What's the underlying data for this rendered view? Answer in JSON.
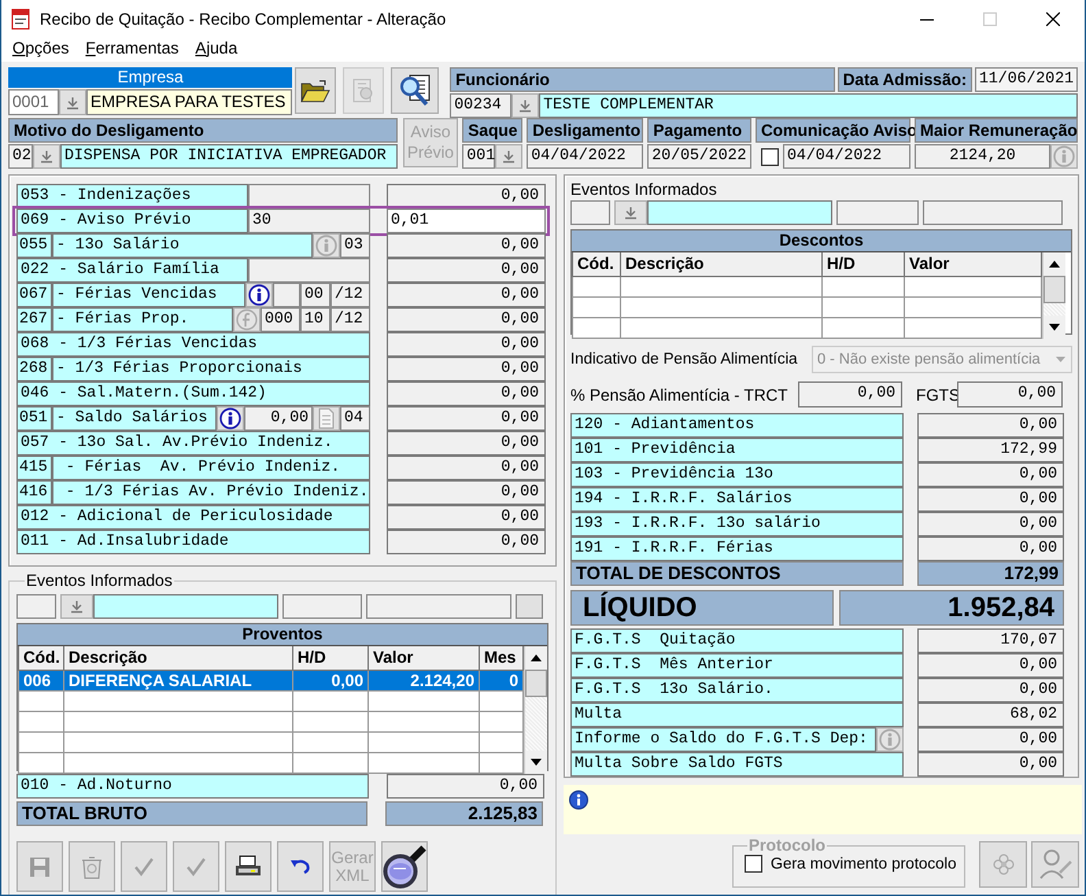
{
  "window": {
    "title": "Recibo de Quitação - Recibo Complementar - Alteração"
  },
  "menu": [
    "Opções",
    "Ferramentas",
    "Ajuda"
  ],
  "empresa": {
    "label": "Empresa",
    "code": "0001",
    "name": "EMPRESA PARA TESTES"
  },
  "top_buttons": [
    {
      "kind": "open-folder",
      "disabled": false
    },
    {
      "kind": "report",
      "disabled": true
    },
    {
      "kind": "search-document",
      "disabled": false
    }
  ],
  "funcionario": {
    "label": "Funcionário",
    "code": "00234",
    "name": "TESTE COMPLEMENTAR"
  },
  "admissao": {
    "label": "Data Admissão:",
    "value": "11/06/2021"
  },
  "motivo": {
    "label": "Motivo do Desligamento",
    "code": "02",
    "name": "DISPENSA POR INICIATIVA EMPREGADOR"
  },
  "aviso_previo_button": {
    "label": "Aviso Prévio",
    "disabled": true
  },
  "saque": {
    "label": "Saque",
    "value": "001"
  },
  "dates": [
    {
      "label": "Desligamento",
      "value": "04/04/2022"
    },
    {
      "label": "Pagamento",
      "value": "20/05/2022"
    }
  ],
  "comunicacao_aviso": {
    "label": "Comunicação Aviso",
    "checked": false,
    "value": "04/04/2022"
  },
  "maior_remuneracao": {
    "label": "Maior Remuneração",
    "value": "2124,20"
  },
  "verbas": [
    {
      "label": "053 - Indenizações",
      "extras": [
        {
          "kind": "field"
        }
      ],
      "value": "0,00",
      "focused": false
    },
    {
      "label": "069 - Aviso Prévio",
      "extras": [
        {
          "kind": "field",
          "text": "30"
        }
      ],
      "value": "0,01",
      "focused": true
    },
    {
      "code": "055",
      "label": "- 13o Salário",
      "extras": [
        {
          "kind": "info",
          "disabled": true
        },
        {
          "kind": "field",
          "text": "03"
        }
      ],
      "value": "0,00",
      "focused": false
    },
    {
      "label": "022 - Salário Família",
      "extras": [
        {
          "kind": "field"
        }
      ],
      "value": "0,00",
      "focused": false
    },
    {
      "code": "067",
      "label": "- Férias Vencidas",
      "extras": [
        {
          "kind": "info",
          "disabled": false
        },
        {
          "kind": "field"
        },
        {
          "kind": "field",
          "text": "00"
        },
        {
          "kind": "field",
          "text": "/12"
        }
      ],
      "value": "0,00",
      "focused": false
    },
    {
      "code": "267",
      "label": "- Férias Prop.",
      "extras": [
        {
          "kind": "function",
          "disabled": true
        },
        {
          "kind": "field",
          "text": "000"
        },
        {
          "kind": "field",
          "text": "10"
        },
        {
          "kind": "field",
          "text": "/12"
        }
      ],
      "value": "0,00",
      "focused": false
    },
    {
      "label": "068 - 1/3 Férias Vencidas",
      "value": "0,00",
      "focused": false
    },
    {
      "code": "268",
      "label": "- 1/3 Férias Proporcionais",
      "value": "0,00",
      "focused": false
    },
    {
      "label": "046 - Sal.Matern.(Sum.142)",
      "value": "0,00",
      "focused": false
    },
    {
      "code": "051",
      "label": "- Saldo Salários",
      "extras": [
        {
          "kind": "info",
          "disabled": false
        },
        {
          "kind": "field",
          "text": "0,00"
        },
        {
          "kind": "document",
          "disabled": true
        },
        {
          "kind": "field",
          "text": "04"
        }
      ],
      "value": "0,00",
      "focused": false
    },
    {
      "label": "057 - 13o Sal. Av.Prévio Indeniz.",
      "value": "0,00",
      "focused": false
    },
    {
      "code": "415",
      "label": " - Férias  Av. Prévio Indeniz.",
      "value": "0,00",
      "focused": false
    },
    {
      "code": "416",
      "label": " - 1/3 Férias Av. Prévio Indeniz.",
      "value": "0,00",
      "focused": false
    },
    {
      "label": "012 - Adicional de Periculosidade",
      "value": "0,00",
      "focused": false
    },
    {
      "label": "011 - Ad.Insalubridade",
      "value": "0,00",
      "focused": false
    }
  ],
  "eventos_proventos": {
    "title": "Eventos Informados",
    "grid_title": "Proventos",
    "columns": [
      "Cód.",
      "Descrição",
      "H/D",
      "Valor",
      "Mes"
    ],
    "rows": [
      {
        "cells": [
          "006",
          "DIFERENÇA SALARIAL",
          "0,00",
          "2.124,20",
          "0"
        ],
        "selected": true
      }
    ]
  },
  "ad_noturno": {
    "label": "010 - Ad.Noturno",
    "value": "0,00"
  },
  "total_bruto": {
    "label": "TOTAL BRUTO",
    "value": "2.125,83"
  },
  "toolbar": [
    {
      "kind": "save",
      "disabled": true
    },
    {
      "kind": "recycle",
      "disabled": true
    },
    {
      "kind": "check",
      "disabled": true
    },
    {
      "kind": "check",
      "disabled": true
    },
    {
      "kind": "print",
      "disabled": false
    },
    {
      "kind": "undo",
      "disabled": false
    },
    {
      "kind": "text",
      "label": "Gerar XML",
      "disabled": true
    },
    {
      "kind": "magnifier",
      "disabled": false
    }
  ],
  "eventos_descontos": {
    "title": "Eventos Informados",
    "grid_title": "Descontos",
    "columns": [
      "Cód.",
      "Descrição",
      "H/D",
      "Valor"
    ]
  },
  "pensao": {
    "label": "Indicativo de Pensão Alimentícia",
    "value": "0 - Não existe pensão alimentícia",
    "disabled": true
  },
  "pensao_trct": {
    "label": "% Pensão Alimentícia - TRCT",
    "value": "0,00"
  },
  "fgts": {
    "label": "FGTS",
    "value": "0,00"
  },
  "descontos": [
    {
      "label": "120 - Adiantamentos",
      "value": "0,00"
    },
    {
      "label": "101 - Previdência",
      "value": "172,99"
    },
    {
      "label": "103 - Previdência 13o",
      "value": "0,00"
    },
    {
      "label": "194 - I.R.R.F. Salários",
      "value": "0,00"
    },
    {
      "label": "193 - I.R.R.F. 13o salário",
      "value": "0,00"
    },
    {
      "label": "191 - I.R.R.F. Férias",
      "value": "0,00"
    }
  ],
  "total_descontos": {
    "label": "TOTAL DE DESCONTOS",
    "value": "172,99"
  },
  "liquido": {
    "label": "LÍQUIDO",
    "value": "1.952,84"
  },
  "fgts_rows": [
    {
      "label": "F.G.T.S  Quitação",
      "value": "170,07",
      "info_button": false
    },
    {
      "label": "F.G.T.S  Mês Anterior",
      "value": "0,00",
      "info_button": false
    },
    {
      "label": "F.G.T.S  13o Salário.",
      "value": "0,00",
      "info_button": false
    },
    {
      "label": "Multa",
      "value": "68,02",
      "info_button": false
    },
    {
      "label": "Informe o Saldo do F.G.T.S Dep:",
      "value": "0,00",
      "info_button": true
    },
    {
      "label": "Multa Sobre Saldo FGTS",
      "value": "0,00",
      "info_button": false
    }
  ],
  "protocolo": {
    "title": "Protocolo",
    "label": "Gera movimento protocolo",
    "checked": false,
    "disabled": true
  },
  "side_buttons": [
    {
      "kind": "network",
      "disabled": true
    },
    {
      "kind": "person-search",
      "disabled": true
    }
  ]
}
